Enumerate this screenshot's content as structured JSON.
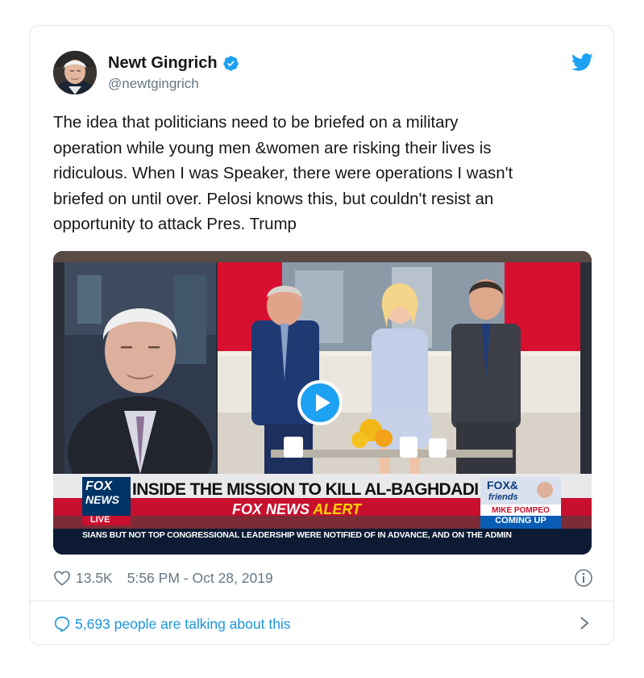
{
  "tweet": {
    "author": {
      "display_name": "Newt Gingrich",
      "handle": "@newtgingrich",
      "verified": true,
      "avatar_icon": "avatar-photo"
    },
    "text": "The idea that politicians need to be briefed on a military\noperation while young men &women are risking their lives is\nridiculous. When I was Speaker, there were operations I wasn't\nbriefed on until over. Pelosi knows this, but couldn't resist an\nopportunity to attack Pres. Trump",
    "media": {
      "type": "video",
      "play_icon": "play-icon",
      "chyron": {
        "network_logo_line1": "FOX",
        "network_logo_line2": "NEWS",
        "network_logo_line3": "LIVE",
        "headline": "INSIDE THE MISSION TO KILL AL-BAGHDADI",
        "alert_prefix": "FOX NEWS",
        "alert_word": "ALERT",
        "show_logo_line1": "FOX&",
        "show_logo_line2": "friends",
        "promo_name": "MIKE POMPEO",
        "promo_status": "COMING UP",
        "ticker": "SIANS BUT NOT TOP CONGRESSIONAL LEADERSHIP WERE NOTIFIED OF IN ADVANCE, AND ON THE ADMIN"
      }
    },
    "likes": "13.5K",
    "timestamp": "5:56 PM - Oct 28, 2019",
    "talking": "5,693 people are talking about this"
  },
  "colors": {
    "twitter_blue": "#1da1f2",
    "link_blue": "#1b95e0",
    "secondary_text": "#657786",
    "border": "#e1e8ed",
    "fox_red": "#c8102e",
    "fox_blue": "#003366"
  },
  "icons": {
    "brand": "twitter-bird-icon",
    "verified": "verified-badge-icon",
    "like": "heart-icon",
    "info": "info-icon",
    "reply": "speech-bubble-icon",
    "navigate": "chevron-right-icon"
  }
}
